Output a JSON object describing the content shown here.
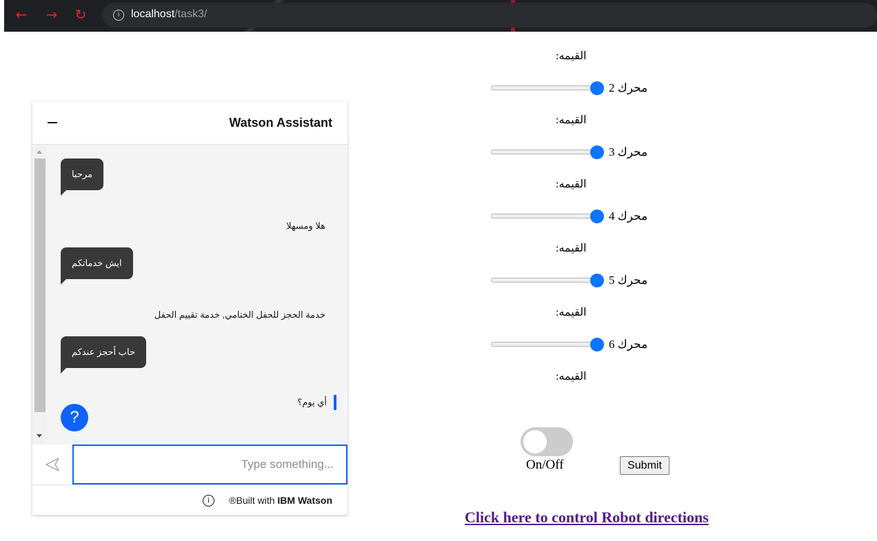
{
  "browser": {
    "url_host": "localhost",
    "url_path": "/task3/",
    "back_icon": "arrow-left-icon",
    "forward_icon": "arrow-right-icon",
    "reload_icon": "reload-icon",
    "info_icon": "info-icon"
  },
  "watson": {
    "title": "Watson Assistant",
    "minimize_icon": "minimize-icon",
    "messages": [
      {
        "type": "user",
        "text": "مرحبا"
      },
      {
        "type": "bot",
        "text": "هلا ومسهلا"
      },
      {
        "type": "user",
        "text": "ايش خدماتكم"
      },
      {
        "type": "bot",
        "text": "خدمة الحجز للحفل الختامي, خدمة تقييم الحفل"
      },
      {
        "type": "user",
        "text": "حاب أحجز عندكم"
      },
      {
        "type": "bot",
        "text": "أي يوم؟"
      }
    ],
    "help_label": "?",
    "input_placeholder": "Type something...",
    "send_icon": "send-icon",
    "footer_prefix": "Built with ",
    "footer_brand": "IBM Watson",
    "footer_mark": "®",
    "footer_icon": "info-icon",
    "accent": "#0f62fe"
  },
  "controls": {
    "value_label": "القيمه:",
    "motors": [
      {
        "label": "محرك 2",
        "value": 1.0
      },
      {
        "label": "محرك 3",
        "value": 1.0
      },
      {
        "label": "محرك 4",
        "value": 1.0
      },
      {
        "label": "محرك 5",
        "value": 1.0
      },
      {
        "label": "محرك 6",
        "value": 1.0
      }
    ],
    "toggle_state": "off",
    "toggle_label": "On/Off",
    "submit_label": "Submit",
    "robot_link": "Click here to control Robot directions",
    "slider_color": "#0f74ff"
  }
}
